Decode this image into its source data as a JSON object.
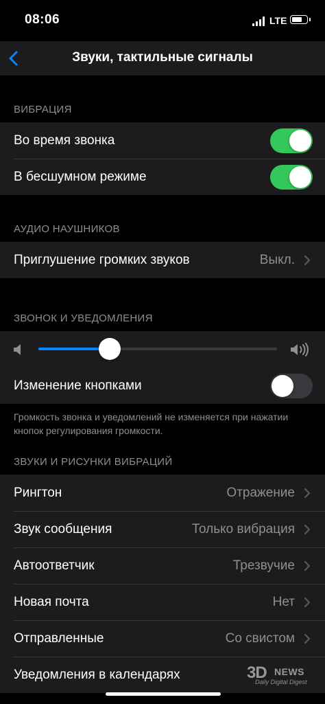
{
  "status_bar": {
    "time": "08:06",
    "network": "LTE"
  },
  "nav": {
    "title": "Звуки, тактильные сигналы"
  },
  "vibration": {
    "header": "ВИБРАЦИЯ",
    "during_call": {
      "label": "Во время звонка",
      "on": true
    },
    "silent_mode": {
      "label": "В бесшумном режиме",
      "on": true
    }
  },
  "headphone_audio": {
    "header": "АУДИО НАУШНИКОВ",
    "loud_sounds": {
      "label": "Приглушение громких звуков",
      "value": "Выкл."
    }
  },
  "ringer": {
    "header": "ЗВОНОК И УВЕДОМЛЕНИЯ",
    "volume_level": 0.3,
    "change_with_buttons": {
      "label": "Изменение кнопками",
      "on": false
    },
    "note": "Громкость звонка и уведомлений не изменяется при нажатии кнопок регулирования громкости."
  },
  "sounds": {
    "header": "ЗВУКИ И РИСУНКИ ВИБРАЦИЙ",
    "items": [
      {
        "label": "Рингтон",
        "value": "Отражение"
      },
      {
        "label": "Звук сообщения",
        "value": "Только вибрация"
      },
      {
        "label": "Автоответчик",
        "value": "Трезвучие"
      },
      {
        "label": "Новая почта",
        "value": "Нет"
      },
      {
        "label": "Отправленные",
        "value": "Со свистом"
      },
      {
        "label": "Уведомления в календарях",
        "value": ""
      }
    ]
  },
  "watermark": {
    "logo": "3D",
    "brand": "NEWS",
    "tagline": "Daily Digital Digest"
  },
  "colors": {
    "accent": "#0a84ff",
    "toggle_on": "#34c759",
    "background": "#000000",
    "cell": "#1c1c1e"
  }
}
